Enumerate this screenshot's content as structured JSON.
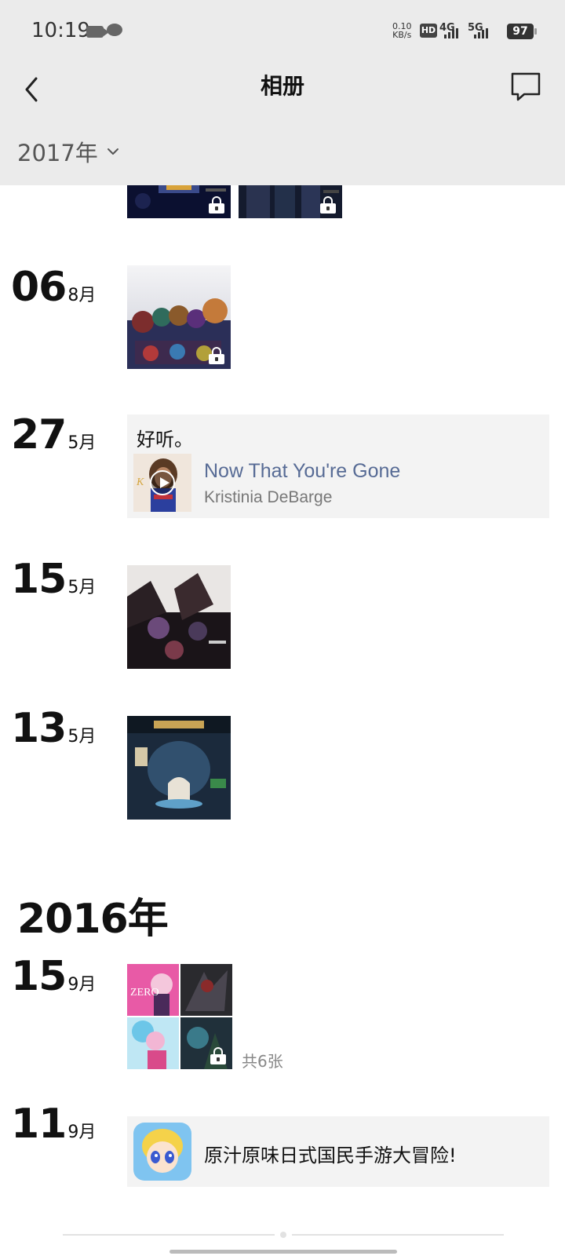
{
  "status_bar": {
    "time": "10:19",
    "net_speed_value": "0.10",
    "net_speed_unit": "KB/s",
    "hd_label": "HD",
    "signal_4g": "4G",
    "signal_5g": "5G",
    "battery": "97"
  },
  "nav": {
    "title": "相册",
    "back_icon": "chevron-left-icon",
    "comment_icon": "comment-icon"
  },
  "year_filter": {
    "selected": "2017年"
  },
  "year_2016": "2016年",
  "entries": [
    {
      "day": "06",
      "month": "8月",
      "type": "photo",
      "locked": true
    },
    {
      "day": "27",
      "month": "5月",
      "type": "music",
      "caption": "好听。",
      "song": "Now That You're Gone",
      "artist": "Kristinia DeBarge"
    },
    {
      "day": "15",
      "month": "5月",
      "type": "photo",
      "locked": false
    },
    {
      "day": "13",
      "month": "5月",
      "type": "photo",
      "locked": false
    },
    {
      "day": "15",
      "month": "9月",
      "type": "photo-grid",
      "count_label": "共6张",
      "locked": true
    },
    {
      "day": "11",
      "month": "9月",
      "type": "link",
      "title": "原汁原味日式国民手游大冒险!"
    }
  ],
  "colors": {
    "header_bg": "#ebebeb",
    "link_blue": "#576b95",
    "card_bg": "#f3f3f3"
  }
}
